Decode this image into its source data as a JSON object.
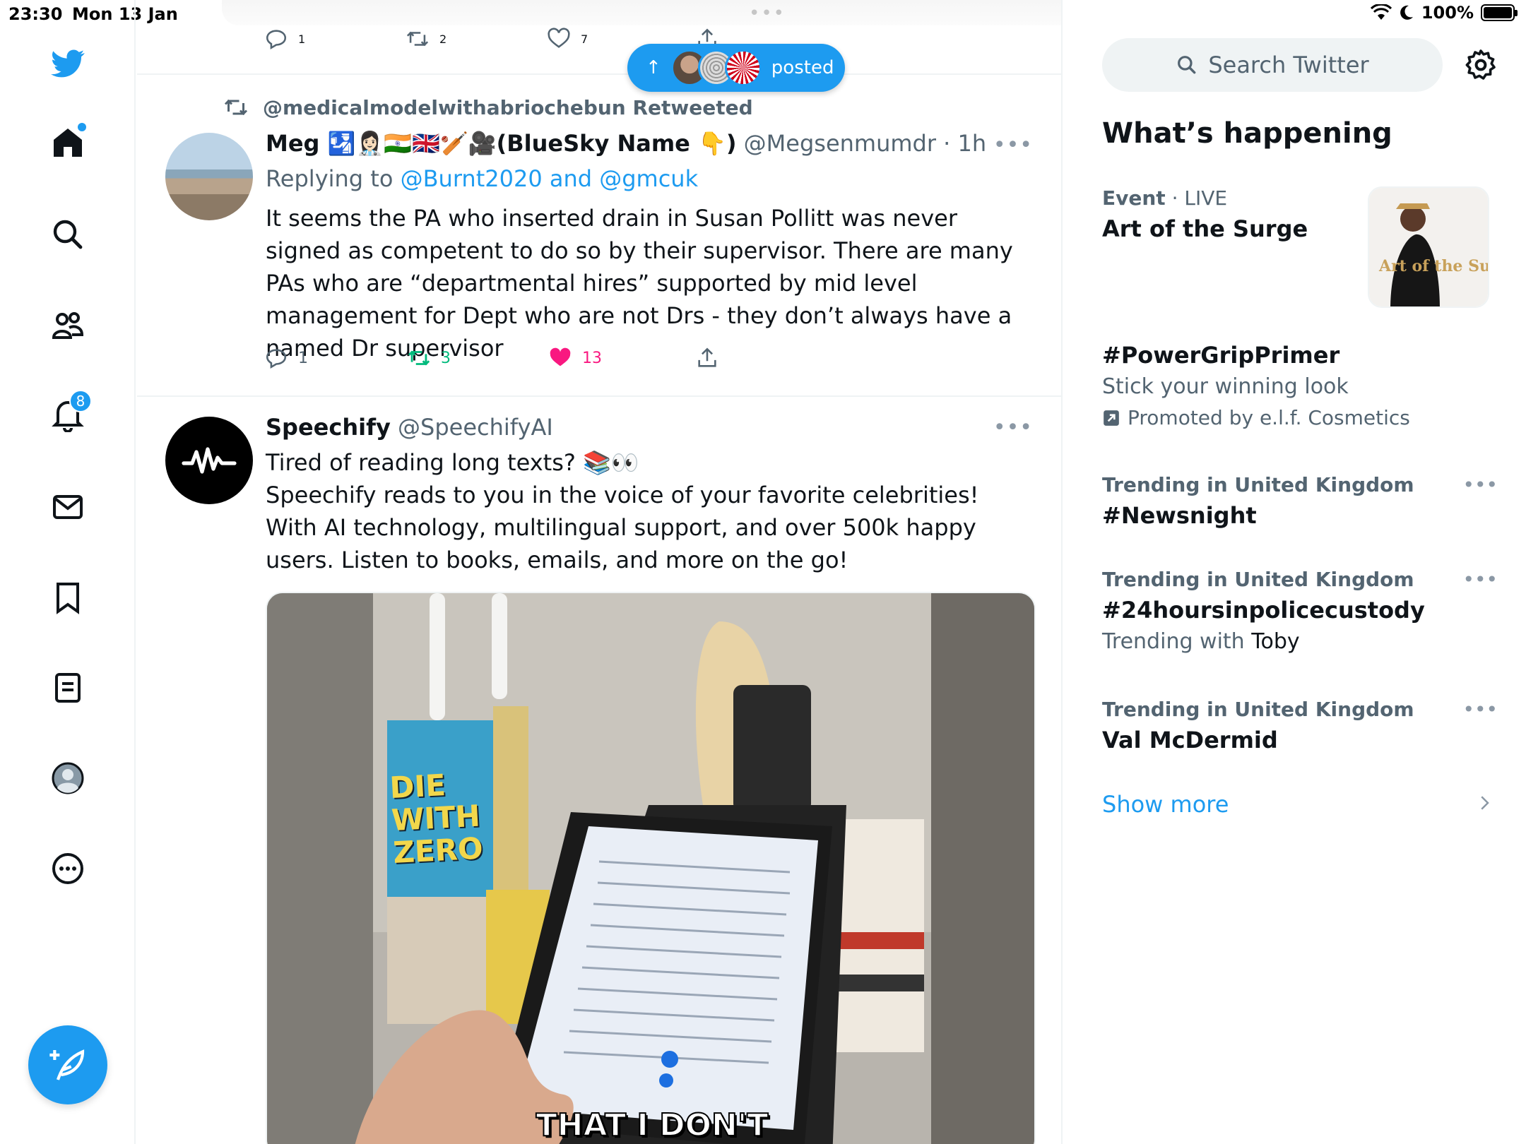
{
  "status_bar": {
    "time": "23:30",
    "date": "Mon 13 Jan",
    "battery": "100%"
  },
  "nav": {
    "notifications_badge": "8"
  },
  "posted_pill": {
    "label": "posted"
  },
  "prev_tweet": {
    "replies": "1",
    "retweets": "2",
    "likes": "7"
  },
  "tweet1": {
    "retweeted_by": "@medicalmodelwithabriochebun Retweeted",
    "name": "Meg 🛂👩🏻‍⚕️🇮🇳🇬🇧🏏🎥(BlueSky Name 👇)",
    "handle": "@Megsenmumdr",
    "time": "· 1h",
    "replying_prefix": "Replying to",
    "replying_to": "@Burnt2020 and @gmcuk",
    "text": "It seems the PA who inserted drain in Susan Pollitt was never signed as competent to do so by their supervisor. There are many PAs who are “departmental hires” supported by mid level management for Dept who are not Drs - they don’t always have a named Dr supervisor",
    "replies": "1",
    "retweets": "3",
    "likes": "13"
  },
  "tweet2": {
    "name": "Speechify",
    "handle": "@SpeechifyAI",
    "text_line1": "Tired of reading long texts? 📚👀",
    "text_body": "Speechify reads to you in the voice of your favorite celebrities! With AI technology, multilingual support, and over 500k happy users. Listen to books, emails, and more on the go!",
    "media_caption": "THAT I DON'T",
    "media_book": "DIE WITH ZERO"
  },
  "sidebar": {
    "search_placeholder": "Search Twitter",
    "section_title": "What’s happening",
    "event": {
      "category": "Event",
      "status": "· LIVE",
      "title": "Art of the Surge",
      "image_text": "Art of the Surge"
    },
    "promoted": {
      "title": "#PowerGripPrimer",
      "subtitle": "Stick your winning look",
      "promoted_by": "Promoted by e.l.f. Cosmetics"
    },
    "trends": [
      {
        "meta": "Trending in United Kingdom",
        "title": "#Newsnight",
        "sub_prefix": "",
        "sub_name": ""
      },
      {
        "meta": "Trending in United Kingdom",
        "title": "#24hoursinpolicecustody",
        "sub_prefix": "Trending with",
        "sub_name": "Toby"
      },
      {
        "meta": "Trending in United Kingdom",
        "title": "Val McDermid",
        "sub_prefix": "",
        "sub_name": ""
      }
    ],
    "show_more": "Show more"
  },
  "colors": {
    "accent": "#1d9bf0",
    "retweet": "#00ba7c",
    "like": "#f91880",
    "muted": "#536471"
  }
}
